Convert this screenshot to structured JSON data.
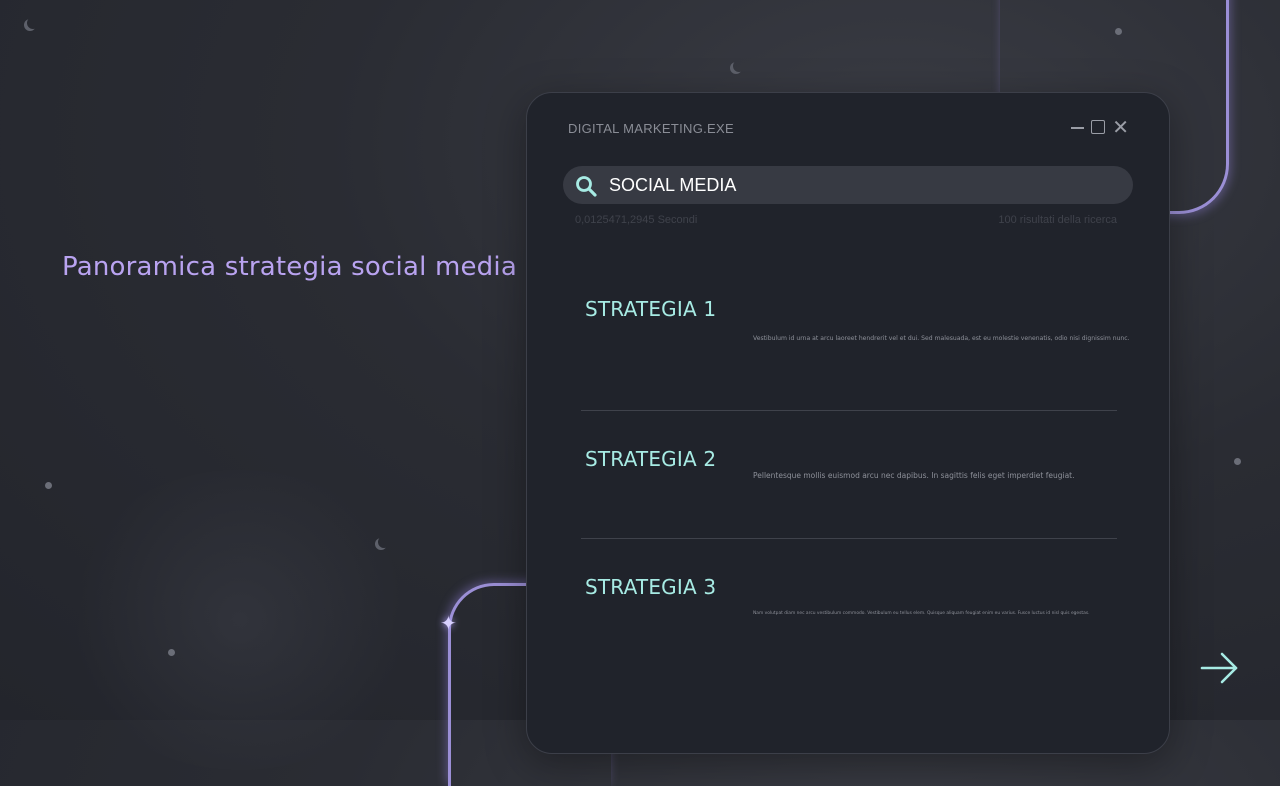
{
  "heading": "Panoramica strategia social media",
  "window": {
    "title": "DIGITAL MARKETING.EXE",
    "controls": [
      "minimize-icon",
      "maximize-icon",
      "close-icon"
    ]
  },
  "search": {
    "value": "SOCIAL MEDIA",
    "placeholder": "",
    "results_time": "0,0125471,2945 Secondi",
    "results_count": "100 risultati della ricerca"
  },
  "strategies": [
    {
      "title": "STRATEGIA 1",
      "description": "Vestibulum id urna at arcu laoreet hendrerit vel et dui. Sed malesuada, est eu molestie venenatis, odio nisi dignissim nunc."
    },
    {
      "title": "STRATEGIA 2",
      "description": "Pellentesque mollis euismod arcu nec dapibus. In sagittis felis eget imperdiet feugiat."
    },
    {
      "title": "STRATEGIA 3",
      "description": "Nam volutpat diam nec arcu vestibulum commodo. Vestibulum eu tellus elem. Quisque aliquam feugiat enim eu varius. Fusce luctus id nisl quis egestas."
    }
  ],
  "colors": {
    "heading": "#b9a3f0",
    "strategy_title": "#a7ebe4",
    "accent_line": "#9b8fd6",
    "arrow": "#a7ebe4"
  },
  "icons": {
    "search": "search-icon",
    "next": "arrow-right-icon",
    "sparkle": "sparkle-icon"
  }
}
